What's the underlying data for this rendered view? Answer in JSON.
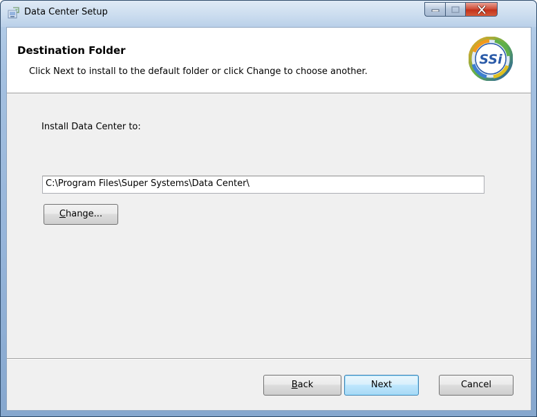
{
  "window": {
    "title": "Data Center Setup",
    "icons": {
      "app": "installer-icon",
      "minimize": "minimize-icon",
      "maximize": "maximize-icon",
      "close": "close-icon"
    }
  },
  "banner": {
    "title": "Destination Folder",
    "description": "Click Next to install to the default folder or click Change to choose another.",
    "logo_text": "SSi",
    "logo_icon": "ssi-logo-icon"
  },
  "main": {
    "install_label": "Install Data Center to:",
    "path_value": "C:\\Program Files\\Super Systems\\Data Center\\",
    "change_button": {
      "mnemonic": "C",
      "rest": "hange..."
    }
  },
  "footer": {
    "back_button": {
      "mnemonic": "B",
      "rest": "ack"
    },
    "next_button": "Next",
    "cancel_button": "Cancel"
  },
  "colors": {
    "accent_focus": "#3c7fb1",
    "close_button": "#c3321c",
    "logo_blue": "#2a5aa8"
  }
}
